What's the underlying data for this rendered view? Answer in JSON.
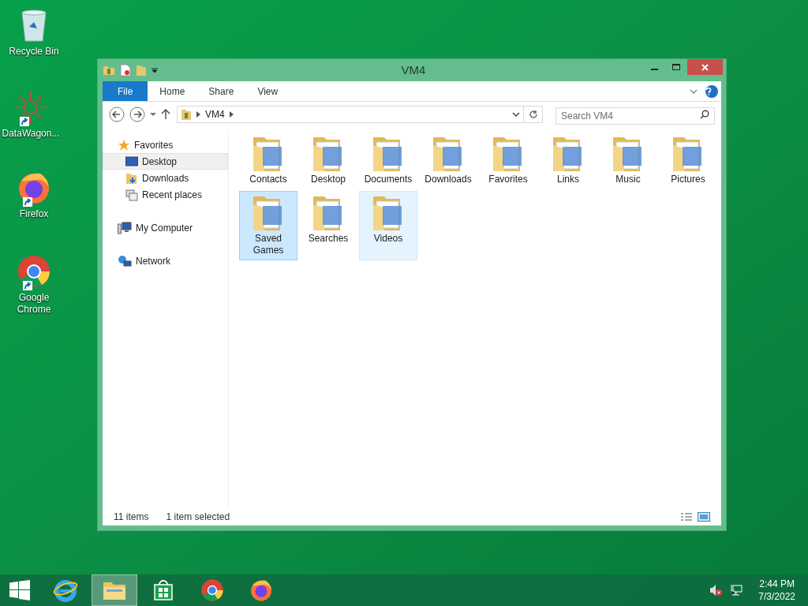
{
  "desktop_icons": [
    {
      "kind": "recycle",
      "label": "Recycle Bin",
      "shortcut": false
    },
    {
      "kind": "datawagon",
      "label": "DataWagon...",
      "shortcut": true
    },
    {
      "kind": "firefox",
      "label": "Firefox",
      "shortcut": true
    },
    {
      "kind": "chrome",
      "label": "Google Chrome",
      "shortcut": true
    }
  ],
  "window": {
    "title": "VM4",
    "ribbon_tabs": [
      {
        "label": "File",
        "kind": "file",
        "selected": false
      },
      {
        "label": "Home",
        "kind": "tab",
        "selected": false
      },
      {
        "label": "Share",
        "kind": "tab",
        "selected": false
      },
      {
        "label": "View",
        "kind": "tab",
        "selected": false
      }
    ],
    "address": {
      "path": "VM4"
    },
    "search": {
      "placeholder": "Search VM4"
    },
    "nav": [
      {
        "label": "Favorites",
        "kind": "star",
        "selected": false,
        "children": [
          {
            "label": "Desktop",
            "kind": "desktop",
            "selected": true
          },
          {
            "label": "Downloads",
            "kind": "downloads",
            "selected": false
          },
          {
            "label": "Recent places",
            "kind": "recent",
            "selected": false
          }
        ]
      },
      {
        "label": "My Computer",
        "kind": "computer",
        "selected": false
      },
      {
        "label": "Network",
        "kind": "network",
        "selected": false
      }
    ],
    "items": [
      {
        "label": "Contacts",
        "selected": false,
        "hovered": false
      },
      {
        "label": "Desktop",
        "selected": false,
        "hovered": false
      },
      {
        "label": "Documents",
        "selected": false,
        "hovered": false
      },
      {
        "label": "Downloads",
        "selected": false,
        "hovered": false
      },
      {
        "label": "Favorites",
        "selected": false,
        "hovered": false
      },
      {
        "label": "Links",
        "selected": false,
        "hovered": false
      },
      {
        "label": "Music",
        "selected": false,
        "hovered": false
      },
      {
        "label": "Pictures",
        "selected": false,
        "hovered": false
      },
      {
        "label": "Saved Games",
        "selected": true,
        "hovered": false
      },
      {
        "label": "Searches",
        "selected": false,
        "hovered": false
      },
      {
        "label": "Videos",
        "selected": false,
        "hovered": true
      }
    ],
    "status_bar": {
      "count": "11 items",
      "selection": "1 item selected"
    }
  },
  "taskbar": {
    "apps": [
      {
        "kind": "ie",
        "selected": false
      },
      {
        "kind": "explorer",
        "selected": true
      },
      {
        "kind": "store",
        "selected": false
      },
      {
        "kind": "chrome",
        "selected": false
      },
      {
        "kind": "firefox",
        "selected": false
      }
    ],
    "time": "2:44 PM",
    "date": "7/3/2022"
  }
}
